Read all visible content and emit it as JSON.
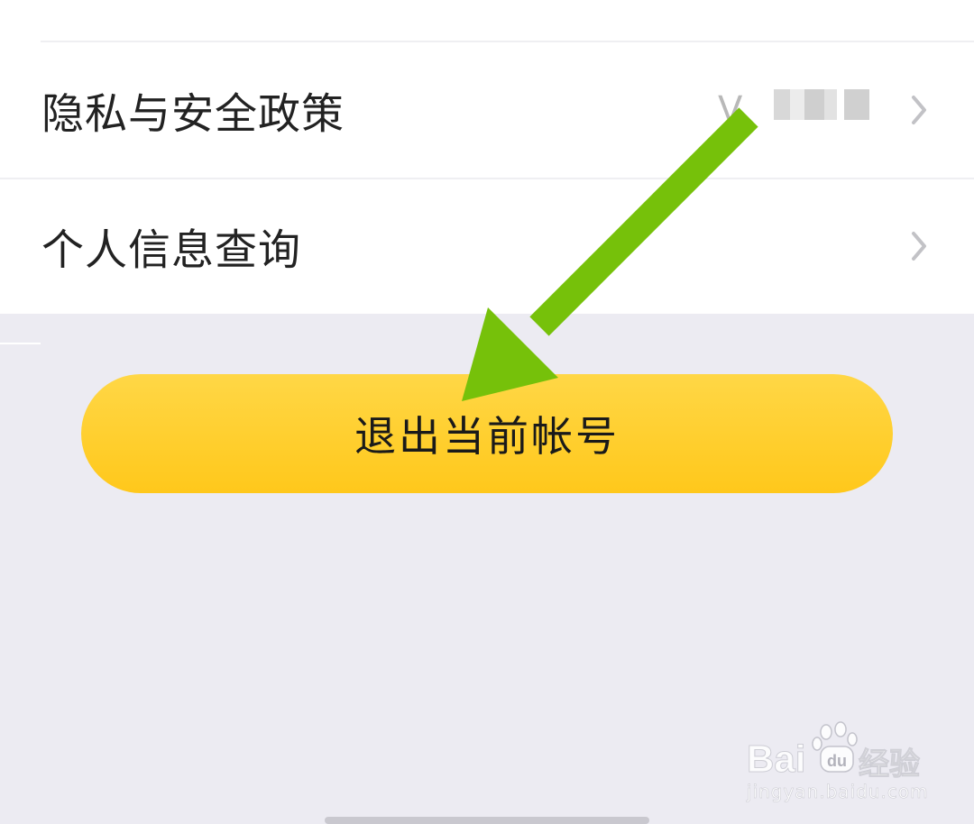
{
  "settings_list": {
    "items": [
      {
        "label": "隐私与安全政策",
        "value": "V"
      },
      {
        "label": "个人信息查询"
      }
    ]
  },
  "logout": {
    "label": "退出当前帐号"
  },
  "icons": {
    "chevron": "chevron-right-icon",
    "annotation": "green-arrow-annotation"
  },
  "watermark": {
    "brand": "Bai",
    "brand_du": "du",
    "product": "经验",
    "url": "jingyan.baidu.com"
  },
  "colors": {
    "background": "#ecebf2",
    "button": "#ffcd2e",
    "arrow": "#76c10a"
  }
}
